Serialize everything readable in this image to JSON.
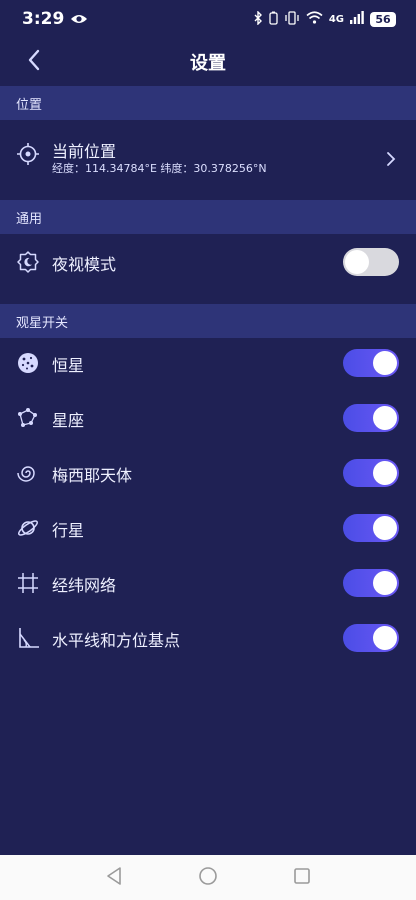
{
  "status_bar": {
    "time": "3:29",
    "network": "4G",
    "battery": "56"
  },
  "header": {
    "title": "设置"
  },
  "sections": {
    "location": {
      "title": "位置",
      "current_label": "当前位置",
      "coords": "经度：114.34784°E 纬度：30.378256°N"
    },
    "general": {
      "title": "通用",
      "night_mode_label": "夜视模式",
      "night_mode_on": false
    },
    "observation": {
      "title": "观星开关",
      "items": [
        {
          "label": "恒星",
          "icon": "star-dots-icon",
          "on": true
        },
        {
          "label": "星座",
          "icon": "constellation-icon",
          "on": true
        },
        {
          "label": "梅西耶天体",
          "icon": "galaxy-icon",
          "on": true
        },
        {
          "label": "行星",
          "icon": "planet-icon",
          "on": true
        },
        {
          "label": "经纬网络",
          "icon": "grid-icon",
          "on": true
        },
        {
          "label": "水平线和方位基点",
          "icon": "horizon-icon",
          "on": true
        }
      ]
    }
  },
  "colors": {
    "background": "#1f2154",
    "section_header": "#2e3478",
    "toggle_on": "#5a52f0",
    "toggle_off": "#d9d9de"
  }
}
